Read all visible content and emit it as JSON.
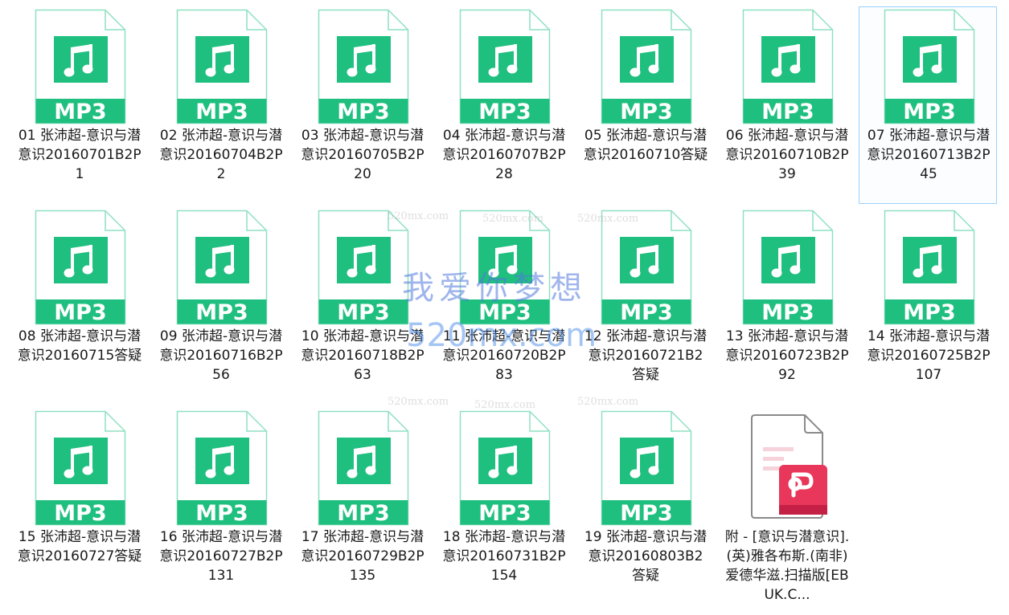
{
  "files": [
    {
      "name": "01 张沛超-意识与潜意识20160701B2P1",
      "type_label": "MP3",
      "icon": "music-note-icon",
      "selected": false
    },
    {
      "name": "02 张沛超-意识与潜意识20160704B2P2",
      "type_label": "MP3",
      "icon": "music-note-icon",
      "selected": false
    },
    {
      "name": "03 张沛超-意识与潜意识20160705B2P20",
      "type_label": "MP3",
      "icon": "music-note-icon",
      "selected": false
    },
    {
      "name": "04 张沛超-意识与潜意识20160707B2P28",
      "type_label": "MP3",
      "icon": "music-note-icon",
      "selected": false
    },
    {
      "name": "05 张沛超-意识与潜意识20160710答疑",
      "type_label": "MP3",
      "icon": "music-note-icon",
      "selected": false
    },
    {
      "name": "06 张沛超-意识与潜意识20160710B2P39",
      "type_label": "MP3",
      "icon": "music-note-icon",
      "selected": false
    },
    {
      "name": "07 张沛超-意识与潜意识20160713B2P45",
      "type_label": "MP3",
      "icon": "music-note-icon",
      "selected": true
    },
    {
      "name": "08 张沛超-意识与潜意识20160715答疑",
      "type_label": "MP3",
      "icon": "music-note-icon",
      "selected": false
    },
    {
      "name": "09 张沛超-意识与潜意识20160716B2P56",
      "type_label": "MP3",
      "icon": "music-note-icon",
      "selected": false
    },
    {
      "name": "10 张沛超-意识与潜意识20160718B2P63",
      "type_label": "MP3",
      "icon": "music-note-icon",
      "selected": false
    },
    {
      "name": "11 张沛超-意识与潜意识20160720B2P83",
      "type_label": "MP3",
      "icon": "music-note-icon",
      "selected": false
    },
    {
      "name": "12 张沛超-意识与潜意识20160721B2答疑",
      "type_label": "MP3",
      "icon": "music-note-icon",
      "selected": false
    },
    {
      "name": "13 张沛超-意识与潜意识20160723B2P92",
      "type_label": "MP3",
      "icon": "music-note-icon",
      "selected": false
    },
    {
      "name": "14 张沛超-意识与潜意识20160725B2P107",
      "type_label": "MP3",
      "icon": "music-note-icon",
      "selected": false
    },
    {
      "name": "15 张沛超-意识与潜意识20160727答疑",
      "type_label": "MP3",
      "icon": "music-note-icon",
      "selected": false
    },
    {
      "name": "16 张沛超-意识与潜意识20160727B2P131",
      "type_label": "MP3",
      "icon": "music-note-icon",
      "selected": false
    },
    {
      "name": "17 张沛超-意识与潜意识20160729B2P135",
      "type_label": "MP3",
      "icon": "music-note-icon",
      "selected": false
    },
    {
      "name": "18 张沛超-意识与潜意识20160731B2P154",
      "type_label": "MP3",
      "icon": "music-note-icon",
      "selected": false
    },
    {
      "name": "19 张沛超-意识与潜意识20160803B2答疑",
      "type_label": "MP3",
      "icon": "music-note-icon",
      "selected": false
    },
    {
      "name": "附 - [意识与潜意识].(英)雅各布斯.(南非)爱德华滋.扫描版[EBUK.C...",
      "type_label": "",
      "icon": "pdf-document-icon",
      "selected": false
    }
  ],
  "watermark": {
    "main": "我爱你梦想",
    "domain": "520mx.com",
    "small": "520mx.com"
  },
  "colors": {
    "mp3_green": "#1fbf7f",
    "mp3_outline": "#8fe0c2",
    "pdf_red": "#e8375a",
    "selection_border": "#99d1ff"
  }
}
